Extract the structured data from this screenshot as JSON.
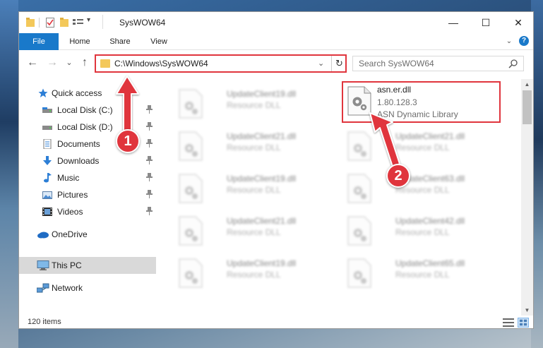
{
  "window": {
    "title": "SysWOW64",
    "minimize": "—",
    "maximize": "☐",
    "close": "✕"
  },
  "ribbon": {
    "tabs": [
      "File",
      "Home",
      "Share",
      "View"
    ],
    "expand_glyph": "⌄",
    "help_glyph": "?"
  },
  "nav": {
    "back": "←",
    "forward": "→",
    "recent": "⌄",
    "up": "↑"
  },
  "address": {
    "path": "C:\\Windows\\SysWOW64",
    "chevron": "⌄",
    "refresh": "↻"
  },
  "search": {
    "placeholder": "Search SysWOW64"
  },
  "sidebar": {
    "items": [
      {
        "label": "Quick access",
        "icon": "star-icon",
        "pinned": false
      },
      {
        "label": "Local Disk (C:)",
        "icon": "drive-icon",
        "pinned": true
      },
      {
        "label": "Local Disk (D:)",
        "icon": "drive-icon",
        "pinned": true
      },
      {
        "label": "Documents",
        "icon": "documents-icon",
        "pinned": true
      },
      {
        "label": "Downloads",
        "icon": "download-icon",
        "pinned": true
      },
      {
        "label": "Music",
        "icon": "music-icon",
        "pinned": true
      },
      {
        "label": "Pictures",
        "icon": "pictures-icon",
        "pinned": true
      },
      {
        "label": "Videos",
        "icon": "videos-icon",
        "pinned": true
      },
      {
        "label": "OneDrive",
        "icon": "cloud-icon",
        "pinned": false
      },
      {
        "label": "This PC",
        "icon": "computer-icon",
        "pinned": false,
        "selected": true
      },
      {
        "label": "Network",
        "icon": "network-icon",
        "pinned": false
      }
    ]
  },
  "files": {
    "highlighted": {
      "name": "asn.er.dll",
      "version": "1.80.128.3",
      "description": "ASN Dynamic Library"
    },
    "blurred": [
      {
        "name": "UpdateClient19.dll",
        "type": "Resource DLL"
      },
      {
        "name": "UpdateClient21.dll",
        "type": "Resource DLL"
      },
      {
        "name": "UpdateClient21.dll",
        "type": "Resource DLL"
      },
      {
        "name": "UpdateClient19.dll",
        "type": "Resource DLL"
      },
      {
        "name": "UpdateClient63.dll",
        "type": "Resource DLL"
      },
      {
        "name": "UpdateClient21.dll",
        "type": "Resource DLL"
      },
      {
        "name": "UpdateClient42.dll",
        "type": "Resource DLL"
      },
      {
        "name": "UpdateClient19.dll",
        "type": "Resource DLL"
      },
      {
        "name": "UpdateClient65.dll",
        "type": "Resource DLL"
      }
    ]
  },
  "status": {
    "item_count": "120 items"
  },
  "annotations": {
    "step1": "1",
    "step2": "2",
    "color": "#e0353d"
  },
  "colors": {
    "accent": "#1979ca",
    "highlight": "#e0353d",
    "selected_bg": "#d9d9d9"
  }
}
